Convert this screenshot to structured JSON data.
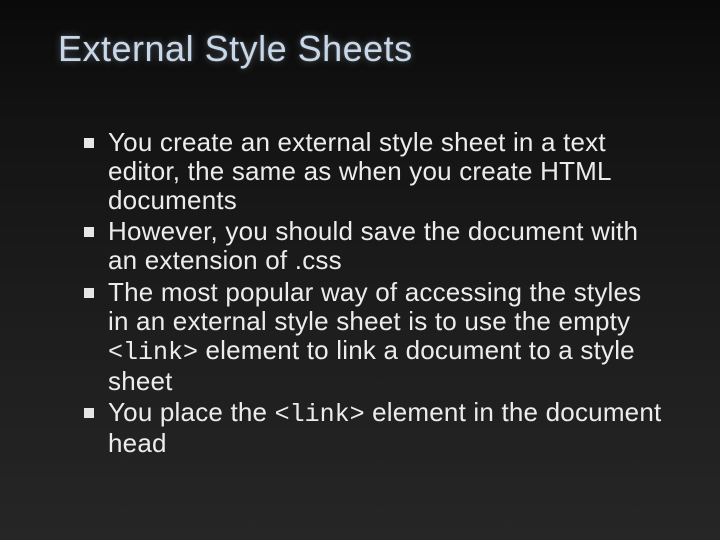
{
  "title": "External Style Sheets",
  "bullets": [
    {
      "pre": "You create an external style sheet in a text editor, the same as when you create HTML documents"
    },
    {
      "pre": "However, you should save the document with an extension of .css"
    },
    {
      "pre": "The most popular way of accessing the styles in an external style sheet is to use the empty ",
      "code": "<link>",
      "post": " element to link a document to a style sheet"
    },
    {
      "pre": "You place the ",
      "code": "<link>",
      "post": " element in the document head"
    }
  ]
}
